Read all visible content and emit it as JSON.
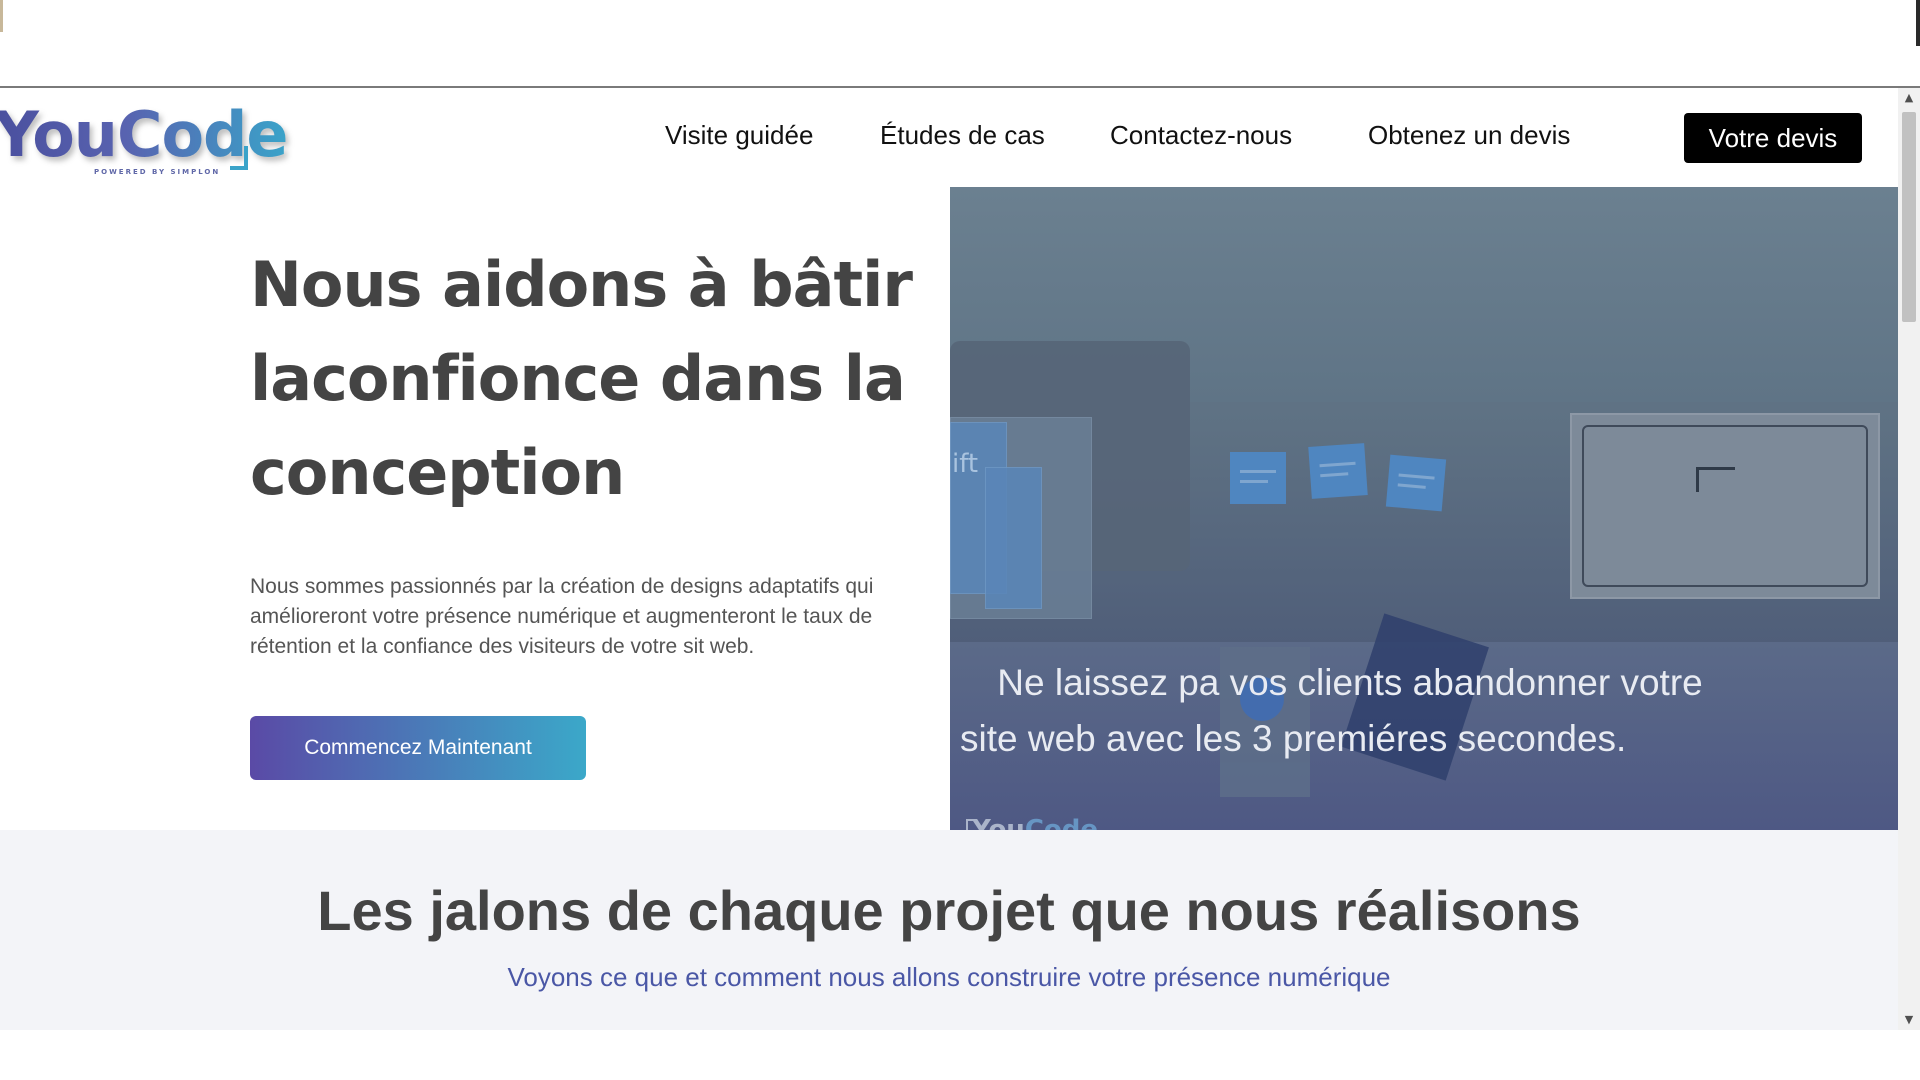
{
  "brand": {
    "logo_text": "YouCode",
    "logo_subtext": "POWERED BY SIMPLON"
  },
  "nav": {
    "items": [
      {
        "label": "Visite guidée"
      },
      {
        "label": "Études de cas"
      },
      {
        "label": "Contactez-nous"
      },
      {
        "label": "Obtenez un devis"
      }
    ],
    "cta_label": "Votre devis"
  },
  "hero": {
    "title": "Nous aidons à bâtir laconfionce dans la conception",
    "text": "Nous sommes passionnés par la création de designs adaptatifs qui amélioreront votre présence numérique et augmenteront le taux de rétention et la confiance des visiteurs de votre sit web.",
    "button_label": "Commencez Maintenant",
    "image_caption_line1": "Ne laissez pa vos clients abandonner votre",
    "image_caption_line2": "site web avec les 3 premiéres secondes.",
    "image_watermark_part1": "You",
    "image_watermark_part2": "Code",
    "image_doc_text": "ift"
  },
  "section": {
    "title": "Les jalons de chaque projet que nous réalisons",
    "subtitle": "Voyons ce que et comment nous allons construire votre présence numérique"
  },
  "colors": {
    "accent_gradient_start": "#5a4aa6",
    "accent_gradient_end": "#3ba8c9",
    "subtitle_blue": "#4a57a6",
    "heading_gray": "#444444"
  },
  "icons": {
    "scroll_up": "▲",
    "scroll_down": "▼"
  }
}
